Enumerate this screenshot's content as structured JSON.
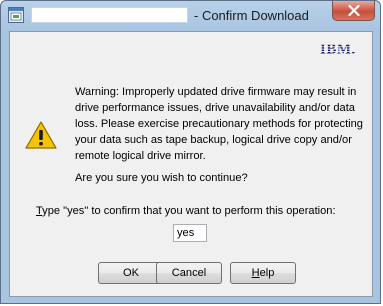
{
  "window": {
    "title": "- Confirm Download",
    "close_symbol": "✕"
  },
  "logo": {
    "text": "IBM."
  },
  "icons": {
    "app": "app-window-icon",
    "warning": "warning-triangle-icon",
    "close": "close-icon"
  },
  "message": {
    "warning": "Warning: Improperly updated drive firmware may result in drive performance issues, drive unavailability and/or data loss. Please exercise precautionary methods for protecting your data such as tape backup, logical drive copy and/or remote logical drive mirror.",
    "question": "Are you sure you wish to continue?"
  },
  "prompt": {
    "mnemonic": "T",
    "rest": "ype \"yes\" to confirm that you want to perform this operation:"
  },
  "input": {
    "value": "yes"
  },
  "buttons": {
    "ok": "OK",
    "cancel": "Cancel",
    "help_mnemonic": "H",
    "help_rest": "elp"
  },
  "colors": {
    "frame": "#b9d1ea",
    "client": "#f0f0f0",
    "close": "#c7503b",
    "warning": "#f5c400"
  }
}
